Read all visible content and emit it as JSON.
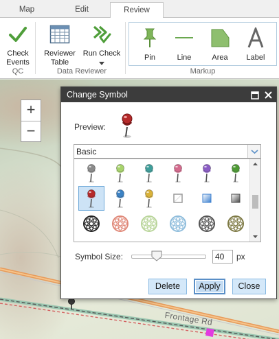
{
  "tabs": [
    {
      "label": "Map",
      "active": false
    },
    {
      "label": "Edit",
      "active": false
    },
    {
      "label": "Review",
      "active": true
    }
  ],
  "ribbon": {
    "buttons": {
      "check_events": {
        "label": "Check Events",
        "icon": "checkmark-icon"
      },
      "reviewer_table": {
        "label": "Reviewer Table",
        "icon": "table-icon"
      },
      "run_check": {
        "label": "Run Check",
        "icon": "double-chevron-check-icon"
      },
      "pin": {
        "label": "Pin",
        "icon": "pushpin-icon"
      },
      "line": {
        "label": "Line",
        "icon": "line-icon"
      },
      "area": {
        "label": "Area",
        "icon": "polygon-icon"
      },
      "label": {
        "label": "Label",
        "icon": "text-a-icon"
      }
    },
    "groups": {
      "qc": "QC",
      "data_reviewer": "Data Reviewer",
      "markup": "Markup"
    }
  },
  "map": {
    "zoom_in": "+",
    "zoom_out": "−",
    "road_label": "Frontage Rd"
  },
  "dialog": {
    "title": "Change Symbol",
    "preview_label": "Preview:",
    "symbol_set": "Basic",
    "symbol_size_label": "Symbol Size:",
    "symbol_size": "40",
    "symbol_size_unit": "px",
    "slider_level": 0.3,
    "buttons": {
      "delete": "Delete",
      "apply": "Apply",
      "close": "Close"
    },
    "symbols": [
      {
        "name": "pushpin-gray-icon",
        "color": "#8a8a8a"
      },
      {
        "name": "pushpin-lightgreen-icon",
        "color": "#a7d36b"
      },
      {
        "name": "pushpin-teal-icon",
        "color": "#3f9e9a"
      },
      {
        "name": "pushpin-pink-icon",
        "color": "#d46a8d"
      },
      {
        "name": "pushpin-purple-icon",
        "color": "#8a5cc4"
      },
      {
        "name": "pushpin-green-icon",
        "color": "#4e9a35"
      },
      {
        "name": "pushpin-red-icon",
        "color": "#b52a2a"
      },
      {
        "name": "pushpin-blue-icon",
        "color": "#3c82c4"
      },
      {
        "name": "pushpin-yellow-icon",
        "color": "#d9b23a"
      },
      {
        "name": "square-outline-icon",
        "color": "#9a9a9a"
      },
      {
        "name": "square-blue-icon",
        "color": "#3b7fcf"
      },
      {
        "name": "square-dark-icon",
        "color": "#4a4a4a"
      },
      {
        "name": "wheel-black-icon",
        "color": "#222222"
      },
      {
        "name": "wheel-salmon-icon",
        "color": "#e08878"
      },
      {
        "name": "wheel-lightgreen-icon",
        "color": "#b9d59a"
      },
      {
        "name": "wheel-lightblue-icon",
        "color": "#8fbddc"
      },
      {
        "name": "wheel-gray-icon",
        "color": "#555555"
      },
      {
        "name": "wheel-olive-icon",
        "color": "#7e7a45"
      }
    ],
    "selected_symbol": 6
  },
  "colors": {
    "accent": "#2b7cd3",
    "check_green": "#4f9e3a",
    "ribbon_icon": "#6aa84f",
    "title_bar": "#3c3c3c"
  }
}
